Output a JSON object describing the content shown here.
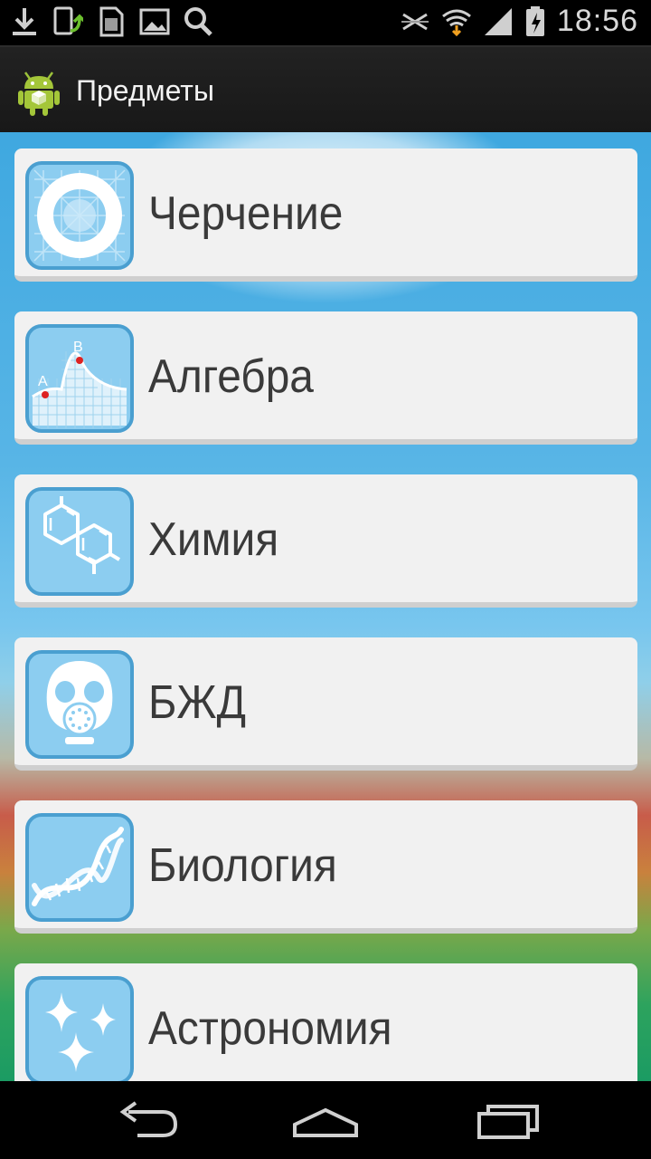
{
  "status_bar": {
    "time": "18:56",
    "left_icons": [
      "download-icon",
      "phone-upload-icon",
      "sd-card-icon",
      "image-icon",
      "search-icon"
    ],
    "right_icons": [
      "no-sim-icon",
      "wifi-icon",
      "signal-icon",
      "battery-charging-icon"
    ]
  },
  "action_bar": {
    "title": "Предметы",
    "icon": "android-app-icon"
  },
  "subjects": [
    {
      "label": "Черчение",
      "icon": "drafting-icon"
    },
    {
      "label": "Алгебра",
      "icon": "graph-icon",
      "icon_text": [
        "A",
        "B"
      ]
    },
    {
      "label": "Химия",
      "icon": "molecule-icon"
    },
    {
      "label": "БЖД",
      "icon": "gas-mask-icon"
    },
    {
      "label": "Биология",
      "icon": "dna-icon"
    },
    {
      "label": "Астрономия",
      "icon": "stars-icon"
    }
  ],
  "nav_bar": {
    "buttons": [
      "back-icon",
      "home-icon",
      "recent-apps-icon"
    ]
  },
  "colors": {
    "card_bg": "#f1f1f1",
    "icon_bg": "#8ccdf0",
    "icon_border": "#4a9fd0",
    "label": "#3a3a3a"
  }
}
